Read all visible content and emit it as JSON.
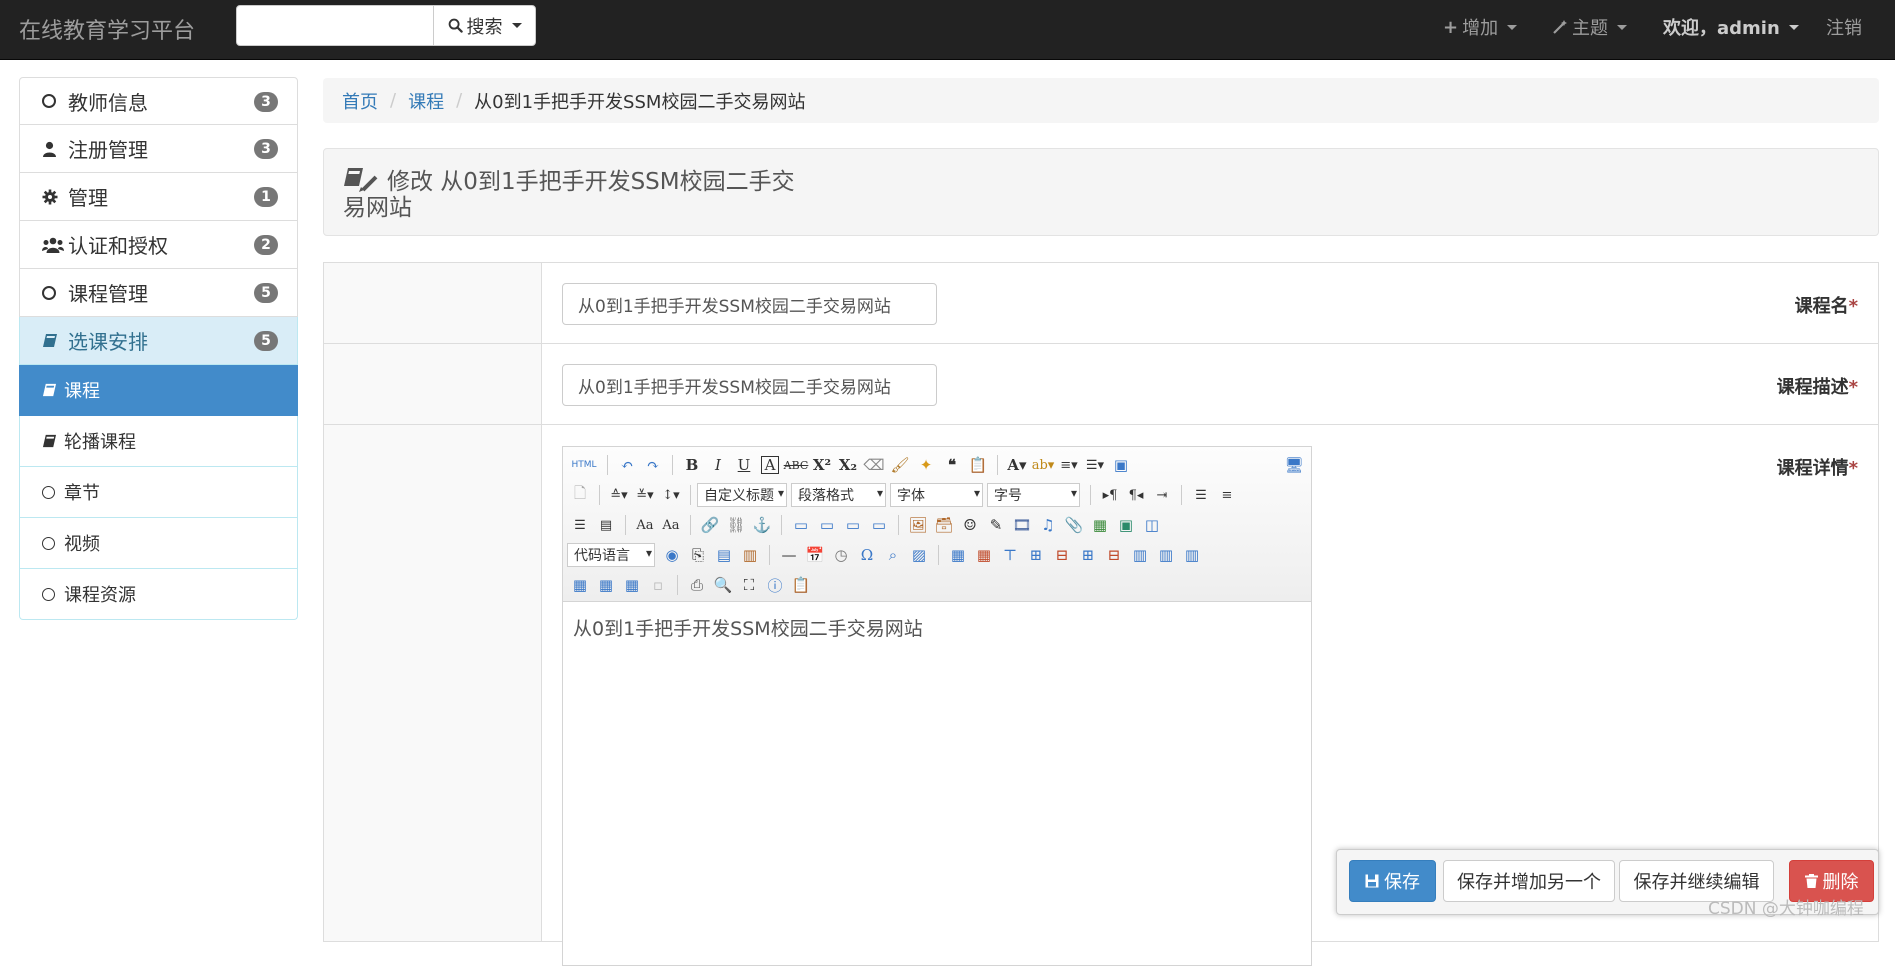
{
  "navbar": {
    "brand": "在线教育学习平台",
    "search_placeholder": "",
    "search_label": "搜索",
    "add_label": "增加",
    "theme_label": "主题",
    "welcome_label": "欢迎，admin",
    "logout_label": "注销"
  },
  "sidebar": {
    "items": [
      {
        "label": "教师信息",
        "badge": "3",
        "icon": "circle-icon"
      },
      {
        "label": "注册管理",
        "badge": "3",
        "icon": "user-icon"
      },
      {
        "label": "管理",
        "badge": "1",
        "icon": "gear-icon"
      },
      {
        "label": "认证和授权",
        "badge": "2",
        "icon": "users-icon"
      },
      {
        "label": "课程管理",
        "badge": "5",
        "icon": "circle-icon"
      },
      {
        "label": "选课安排",
        "badge": "5",
        "icon": "book-icon"
      }
    ],
    "subitems": [
      {
        "label": "课程",
        "icon": "book-icon"
      },
      {
        "label": "轮播课程",
        "icon": "book-icon"
      },
      {
        "label": "章节",
        "icon": "circle-icon"
      },
      {
        "label": "视频",
        "icon": "circle-icon"
      },
      {
        "label": "课程资源",
        "icon": "circle-icon"
      }
    ]
  },
  "breadcrumb": {
    "home": "首页",
    "section": "课程",
    "current": "从0到1手把手开发SSM校园二手交易网站"
  },
  "page": {
    "title": "修改 从0到1手把手开发SSM校园二手交易网站"
  },
  "form": {
    "name_label": "课程名",
    "name_value": "从0到1手把手开发SSM校园二手交易网站",
    "desc_label": "课程描述",
    "desc_value": "从0到1手把手开发SSM校园二手交易网站",
    "detail_label": "课程详情",
    "required_mark": "*"
  },
  "editor": {
    "html_label": "HTML",
    "custom_title": "自定义标题",
    "paragraph": "段落格式",
    "font_family": "字体",
    "font_size": "字号",
    "code_lang": "代码语言",
    "content": "从0到1手把手开发SSM校园二手交易网站"
  },
  "actions": {
    "save": "保存",
    "save_add": "保存并增加另一个",
    "save_continue": "保存并继续编辑",
    "delete": "删除"
  },
  "watermark": "CSDN @大钟咖编程",
  "colors": {
    "primary": "#428bca",
    "danger": "#d9534f",
    "navbar": "#222222",
    "active_group": "#d9edf7"
  }
}
